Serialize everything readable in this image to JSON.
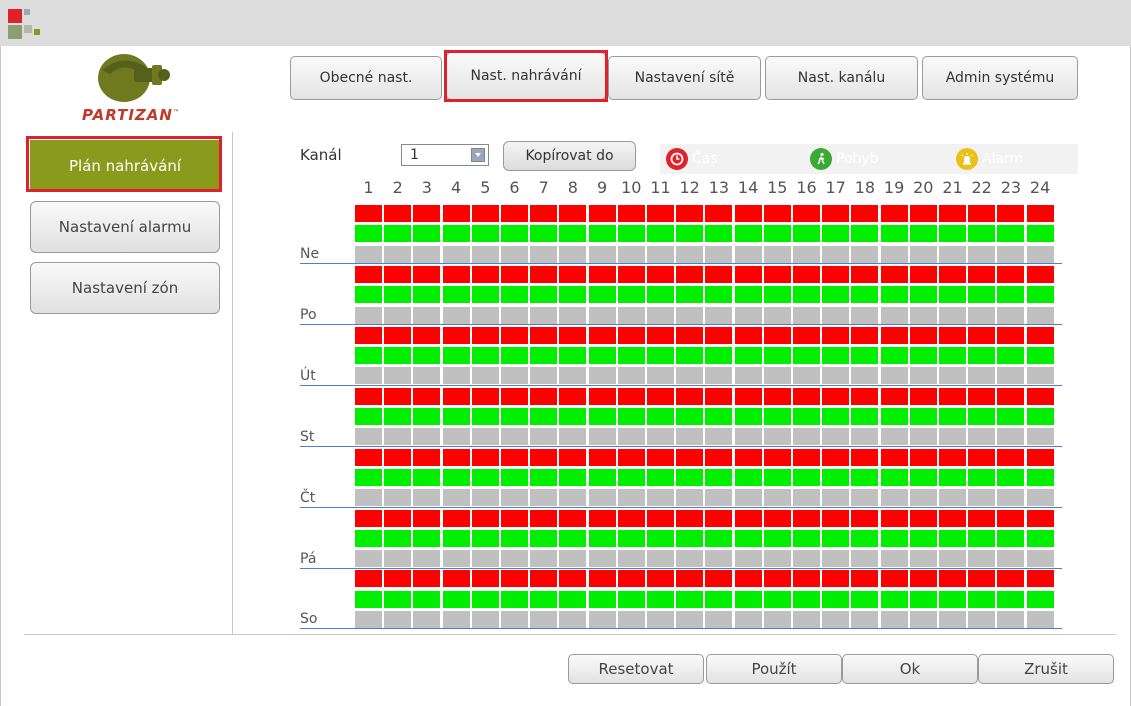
{
  "brand": {
    "name": "PARTIZAN",
    "tm": "™"
  },
  "tabs": [
    {
      "label": "Obecné nast."
    },
    {
      "label": "Nast. nahrávání"
    },
    {
      "label": "Nastavení sítě"
    },
    {
      "label": "Nast. kanálu"
    },
    {
      "label": "Admin systému"
    }
  ],
  "sidebar": [
    {
      "label": "Plán nahrávání"
    },
    {
      "label": "Nastavení alarmu"
    },
    {
      "label": "Nastavení zón"
    }
  ],
  "toolbar": {
    "channel_label": "Kanál",
    "channel_value": "1",
    "copy_label": "Kopírovat do"
  },
  "legend": [
    {
      "label": "Čas",
      "color": "#e0202a",
      "icon": "clock-icon"
    },
    {
      "label": "Pohyb",
      "color": "#3aaa35",
      "icon": "walking-person-icon"
    },
    {
      "label": "Alarm",
      "color": "#e8c21a",
      "icon": "alarm-siren-icon"
    }
  ],
  "hours": [
    "1",
    "2",
    "3",
    "4",
    "5",
    "6",
    "7",
    "8",
    "9",
    "10",
    "11",
    "12",
    "13",
    "14",
    "15",
    "16",
    "17",
    "18",
    "19",
    "20",
    "21",
    "22",
    "23",
    "24"
  ],
  "days": [
    "Ne",
    "Po",
    "Út",
    "St",
    "Čt",
    "Pá",
    "So"
  ],
  "schedule_colors": {
    "time": "#ff0000",
    "motion": "#00ee00",
    "alarm": "#c0c0c0"
  },
  "footer": {
    "reset": "Resetovat",
    "apply": "Použít",
    "ok": "Ok",
    "cancel": "Zrušit"
  }
}
